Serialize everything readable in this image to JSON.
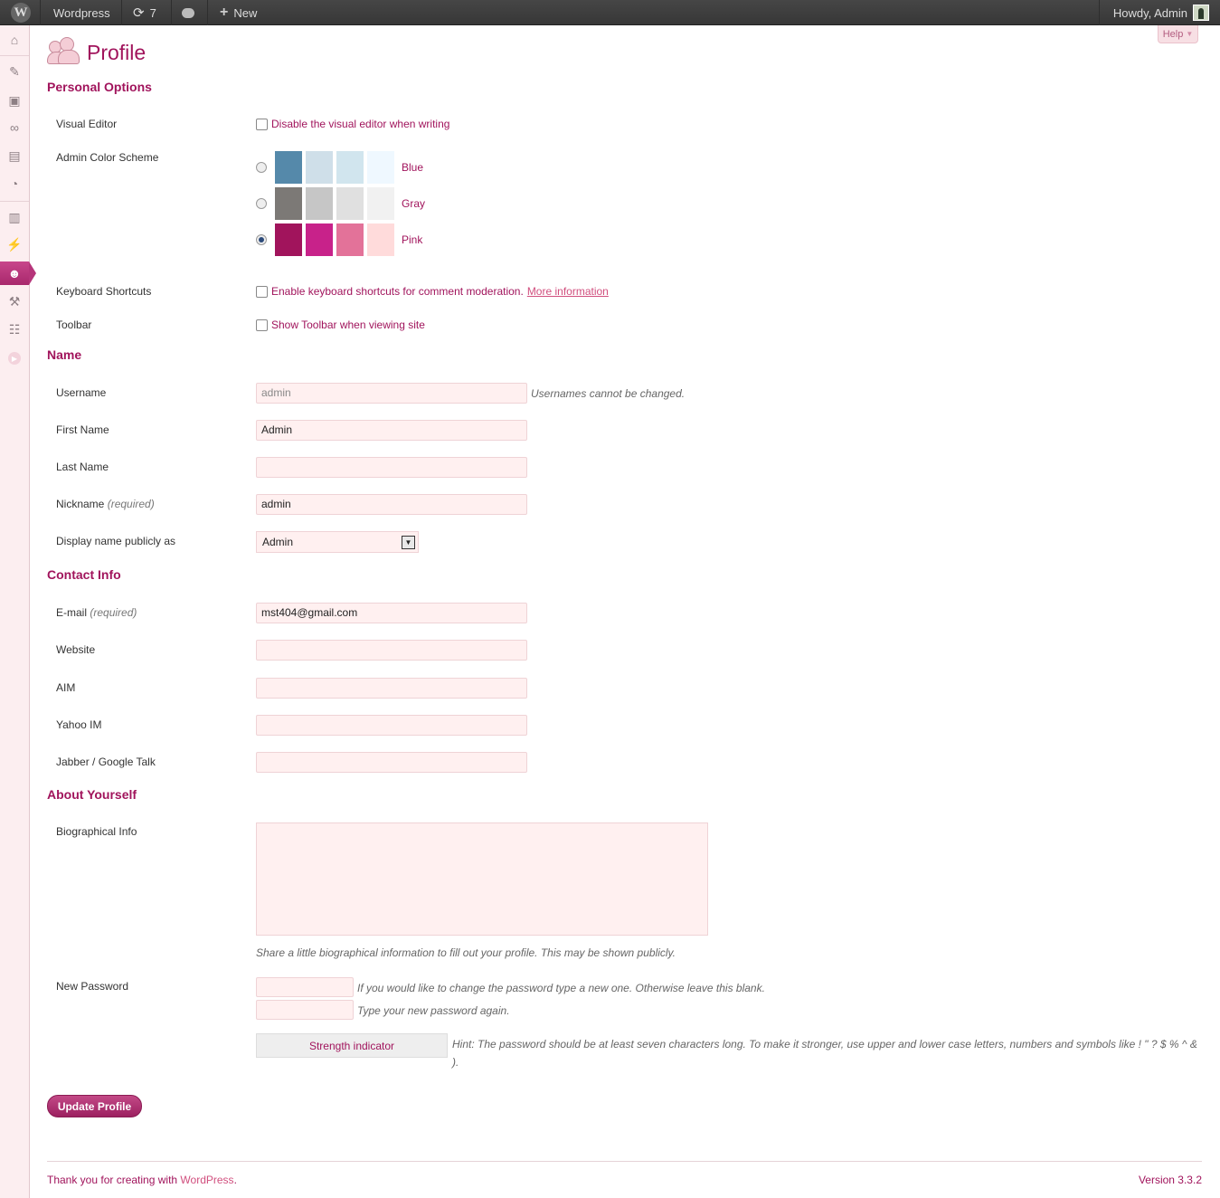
{
  "adminbar": {
    "wp_logo": "wordpress-logo",
    "site_name": "Wordpress",
    "updates_count": "7",
    "new_label": "New",
    "howdy": "Howdy, Admin"
  },
  "sidebar": {
    "icons": [
      "dashboard-icon",
      "posts-icon",
      "media-icon",
      "links-icon",
      "pages-icon",
      "comments-icon",
      "appearance-icon",
      "plugins-icon",
      "users-icon",
      "tools-icon",
      "settings-icon",
      "collapse-icon"
    ],
    "active": "users-icon"
  },
  "page": {
    "title": "Profile",
    "help": "Help"
  },
  "personal": {
    "heading": "Personal Options",
    "visual_editor_label": "Visual Editor",
    "visual_editor_option": "Disable the visual editor when writing",
    "color_scheme_label": "Admin Color Scheme",
    "schemes": [
      {
        "name": "Blue",
        "colors": [
          "#5589aa",
          "#cfdfe9",
          "#d1e5ee",
          "#eff8ff"
        ],
        "selected": false
      },
      {
        "name": "Gray",
        "colors": [
          "#7c7976",
          "#c6c6c6",
          "#e0e0e0",
          "#f1f1f1"
        ],
        "selected": false
      },
      {
        "name": "Pink",
        "colors": [
          "#a1145c",
          "#c8228a",
          "#e37299",
          "#ffdbdb"
        ],
        "selected": true
      }
    ],
    "keyboard_label": "Keyboard Shortcuts",
    "keyboard_option": "Enable keyboard shortcuts for comment moderation.",
    "keyboard_link": "More information",
    "toolbar_label": "Toolbar",
    "toolbar_option": "Show Toolbar when viewing site"
  },
  "name": {
    "heading": "Name",
    "username_label": "Username",
    "username_value": "admin",
    "username_note": "Usernames cannot be changed.",
    "first_label": "First Name",
    "first_value": "Admin",
    "last_label": "Last Name",
    "last_value": "",
    "nickname_label": "Nickname",
    "required": "(required)",
    "nickname_value": "admin",
    "display_label": "Display name publicly as",
    "display_value": "Admin"
  },
  "contact": {
    "heading": "Contact Info",
    "email_label": "E-mail",
    "email_value": "mst404@gmail.com",
    "website_label": "Website",
    "aim_label": "AIM",
    "yahoo_label": "Yahoo IM",
    "jabber_label": "Jabber / Google Talk"
  },
  "about": {
    "heading": "About Yourself",
    "bio_label": "Biographical Info",
    "bio_note": "Share a little biographical information to fill out your profile. This may be shown publicly.",
    "password_label": "New Password",
    "password_note1": "If you would like to change the password type a new one. Otherwise leave this blank.",
    "password_note2": "Type your new password again.",
    "strength": "Strength indicator",
    "hint": "Hint: The password should be at least seven characters long. To make it stronger, use upper and lower case letters, numbers and symbols like ! \" ? $ % ^ & )."
  },
  "submit": "Update Profile",
  "footer": {
    "thanks": "Thank you for creating with",
    "wordpress": "WordPress",
    "version": "Version 3.3.2"
  }
}
